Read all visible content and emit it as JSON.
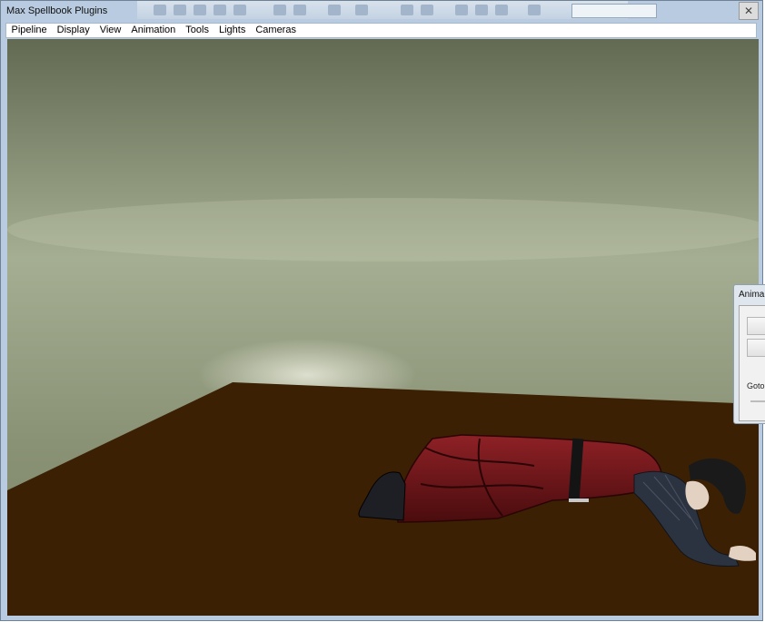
{
  "window": {
    "title": "Max Spellbook Plugins",
    "close_glyph": "✕"
  },
  "menubar": {
    "items": [
      "Pipeline",
      "Display",
      "View",
      "Animation",
      "Tools",
      "Lights",
      "Cameras"
    ]
  },
  "panel": {
    "title": "Anima",
    "goto_label": "Goto"
  },
  "colors": {
    "floor": "#3b2004",
    "wall_top": "#626a52",
    "wall_mid": "#a5ae92",
    "coat": "#6e1417",
    "jacket": "#2c3340",
    "skin": "#e3d2c1",
    "hair": "#1a1a1a"
  },
  "icons": [
    "close-icon"
  ]
}
